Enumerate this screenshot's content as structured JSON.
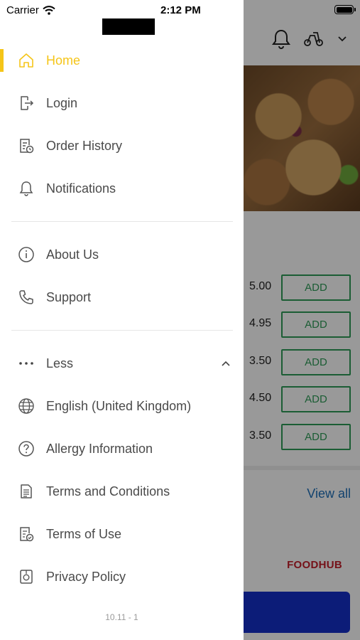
{
  "status_bar": {
    "carrier": "Carrier",
    "time": "2:12 PM"
  },
  "drawer": {
    "primary_items": [
      {
        "label": "Home",
        "icon": "home-icon",
        "active": true
      },
      {
        "label": "Login",
        "icon": "login-icon",
        "active": false
      },
      {
        "label": "Order History",
        "icon": "order-history-icon",
        "active": false
      },
      {
        "label": "Notifications",
        "icon": "bell-icon",
        "active": false
      }
    ],
    "secondary_items": [
      {
        "label": "About Us",
        "icon": "info-icon"
      },
      {
        "label": "Support",
        "icon": "phone-icon"
      }
    ],
    "more_toggle": {
      "label": "Less",
      "icon": "more-dots-icon",
      "state": "expanded"
    },
    "more_items": [
      {
        "label": "English (United Kingdom)",
        "icon": "globe-icon"
      },
      {
        "label": "Allergy Information",
        "icon": "question-icon"
      },
      {
        "label": "Terms and Conditions",
        "icon": "document-icon"
      },
      {
        "label": "Terms of Use",
        "icon": "document-check-icon"
      },
      {
        "label": "Privacy Policy",
        "icon": "privacy-icon"
      }
    ],
    "version": "10.11 - 1"
  },
  "background": {
    "prices": [
      "5.00",
      "4.95",
      "3.50",
      "4.50",
      "3.50"
    ],
    "add_label": "ADD",
    "view_all": "View all",
    "brand": "FOODHUB"
  },
  "colors": {
    "accent": "#f5c518",
    "add_green": "#2e9b57",
    "link_blue": "#1f6fb8",
    "brand_red": "#c41e2a",
    "button_blue": "#1530c9"
  }
}
